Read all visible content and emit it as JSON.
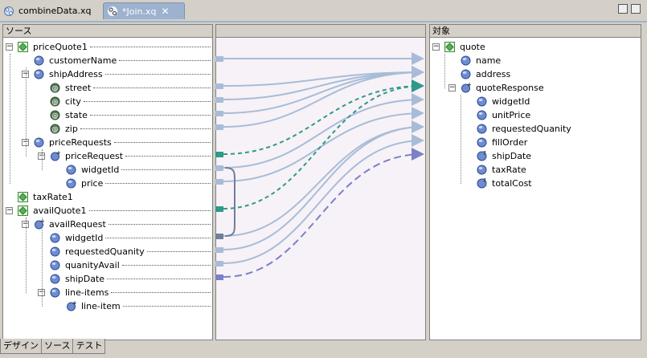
{
  "tabs": [
    {
      "label": "combineData.xq",
      "icon": "xquery-file-icon",
      "active": false
    },
    {
      "label": "*Join.xq",
      "icon": "xquery-file-icon",
      "active": true
    }
  ],
  "source_header": "ソース",
  "target_header": "対象",
  "source_tree": [
    {
      "label": "priceQuote1",
      "level": 0,
      "icon": "schema-root-icon",
      "expander": "minus"
    },
    {
      "label": "customerName",
      "level": 1,
      "icon": "element-icon"
    },
    {
      "label": "shipAddress",
      "level": 1,
      "icon": "element-icon",
      "expander": "minus"
    },
    {
      "label": "street",
      "level": 2,
      "icon": "attribute-icon"
    },
    {
      "label": "city",
      "level": 2,
      "icon": "attribute-icon"
    },
    {
      "label": "state",
      "level": 2,
      "icon": "attribute-icon"
    },
    {
      "label": "zip",
      "level": 2,
      "icon": "attribute-icon"
    },
    {
      "label": "priceRequests",
      "level": 1,
      "icon": "element-icon",
      "expander": "minus"
    },
    {
      "label": "priceRequest",
      "level": 2,
      "icon": "repeating-element-icon",
      "expander": "minus"
    },
    {
      "label": "widgetId",
      "level": 3,
      "icon": "element-icon"
    },
    {
      "label": "price",
      "level": 3,
      "icon": "element-icon"
    },
    {
      "label": "taxRate1",
      "level": 0,
      "icon": "schema-root-icon"
    },
    {
      "label": "availQuote1",
      "level": 0,
      "icon": "schema-root-icon",
      "expander": "minus"
    },
    {
      "label": "availRequest",
      "level": 1,
      "icon": "repeating-element-icon",
      "expander": "minus"
    },
    {
      "label": "widgetId",
      "level": 2,
      "icon": "element-icon"
    },
    {
      "label": "requestedQuanity",
      "level": 2,
      "icon": "element-icon"
    },
    {
      "label": "quanityAvail",
      "level": 2,
      "icon": "element-icon"
    },
    {
      "label": "shipDate",
      "level": 2,
      "icon": "element-icon"
    },
    {
      "label": "line-items",
      "level": 2,
      "icon": "element-icon",
      "expander": "minus"
    },
    {
      "label": "line-item",
      "level": 3,
      "icon": "repeating-element-icon"
    }
  ],
  "target_tree": [
    {
      "label": "quote",
      "level": 0,
      "icon": "schema-root-icon",
      "expander": "minus"
    },
    {
      "label": "name",
      "level": 1,
      "icon": "target-element-icon"
    },
    {
      "label": "address",
      "level": 1,
      "icon": "target-element-icon"
    },
    {
      "label": "quoteResponse",
      "level": 1,
      "icon": "target-repeating-icon",
      "expander": "minus"
    },
    {
      "label": "widgetId",
      "level": 2,
      "icon": "target-element-icon"
    },
    {
      "label": "unitPrice",
      "level": 2,
      "icon": "target-element-icon"
    },
    {
      "label": "requestedQuanity",
      "level": 2,
      "icon": "target-element-icon"
    },
    {
      "label": "fillOrder",
      "level": 2,
      "icon": "target-element-icon"
    },
    {
      "label": "shipDate",
      "level": 2,
      "icon": "target-optional-icon"
    },
    {
      "label": "taxRate",
      "level": 2,
      "icon": "target-element-icon"
    },
    {
      "label": "totalCost",
      "level": 2,
      "icon": "target-optional-icon"
    }
  ],
  "bottom_tabs": [
    {
      "label": "デザイン",
      "active": true
    },
    {
      "label": "ソース",
      "active": false
    },
    {
      "label": "テスト",
      "active": false
    }
  ],
  "colors": {
    "mapping_line": "#a8bcd8",
    "join_dashed": "#2e9a8a",
    "optional_dashed": "#7b80c8",
    "active_tab": "#9db2cf"
  }
}
